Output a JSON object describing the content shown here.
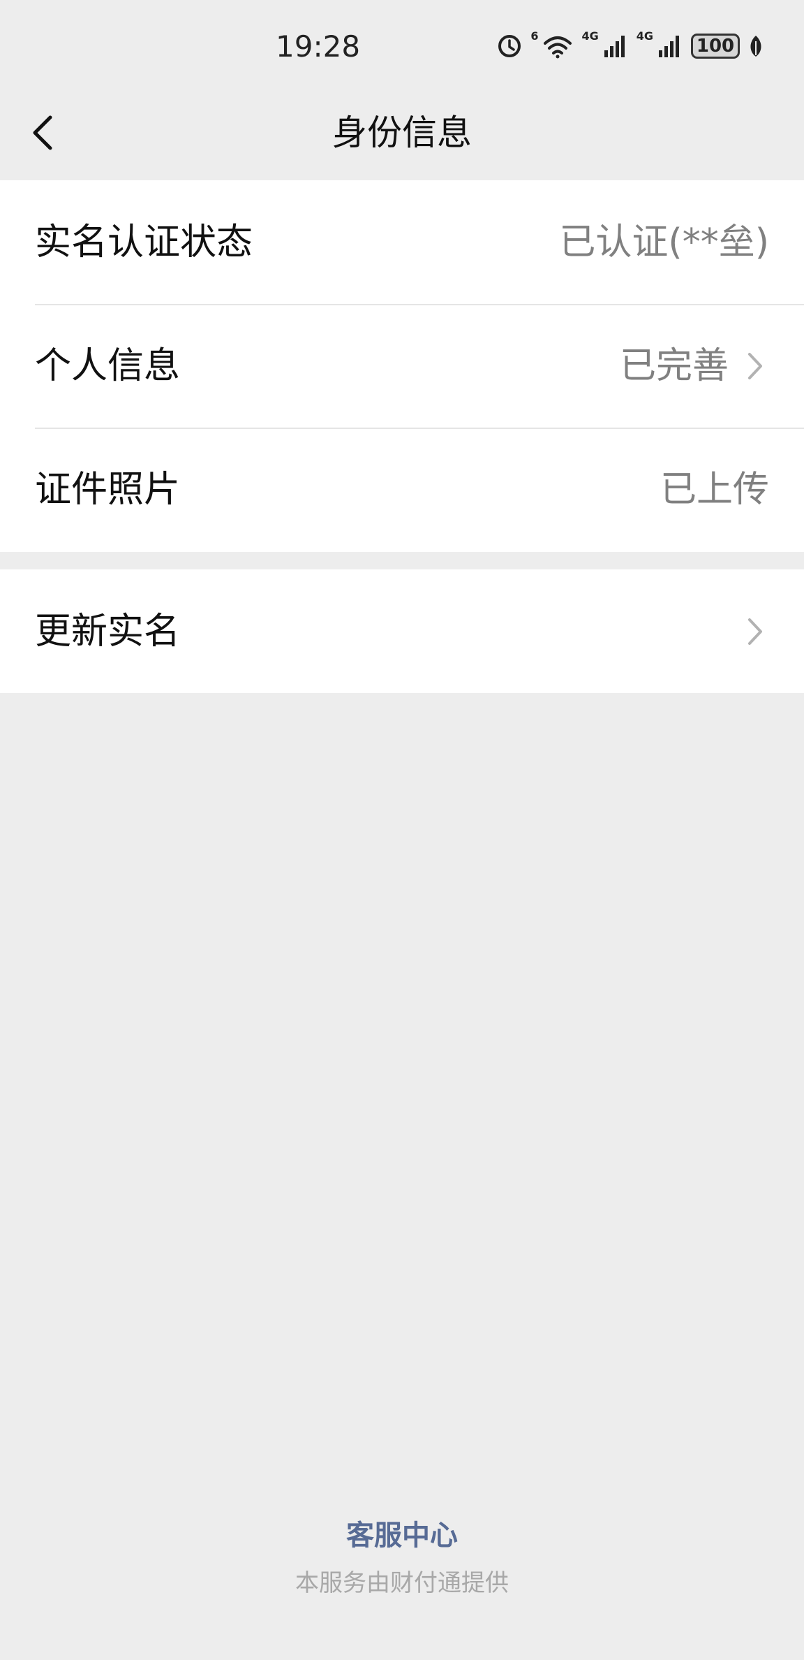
{
  "status_bar": {
    "time": "19:28",
    "wifi_label": "6",
    "network_1_label": "4G",
    "network_2_label": "4G",
    "battery_level": "100"
  },
  "nav": {
    "title": "身份信息"
  },
  "identity_rows": [
    {
      "label": "实名认证状态",
      "value": "已认证(**垒)"
    },
    {
      "label": "个人信息",
      "value": "已完善"
    },
    {
      "label": "证件照片",
      "value": "已上传"
    }
  ],
  "update_row": {
    "label": "更新实名"
  },
  "footer": {
    "link": "客服中心",
    "note": "本服务由财付通提供"
  },
  "colors": {
    "background": "#ededed",
    "cell_background": "#ffffff",
    "value_text": "#808080",
    "link": "#576b95",
    "footer_note": "#a8a8a8"
  }
}
